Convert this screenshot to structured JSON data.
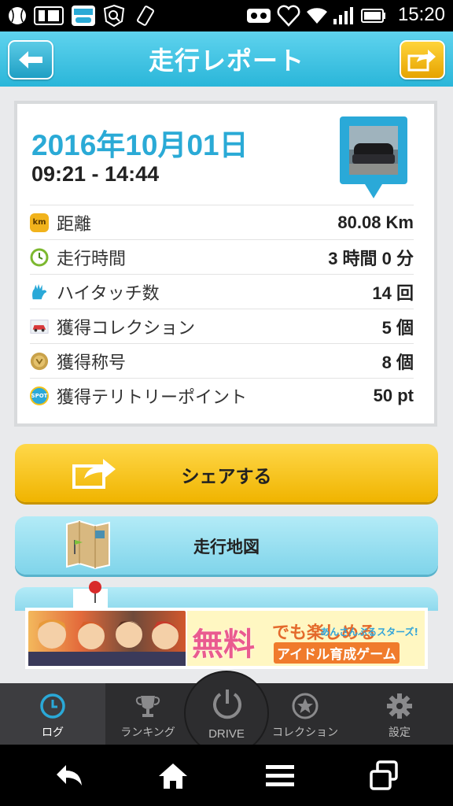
{
  "status_bar": {
    "time": "15:20",
    "icons": [
      "baseball-icon",
      "sim-icon",
      "app-notification-icon",
      "search-notification-icon",
      "rotate-icon",
      "vr-icon",
      "heart-icon",
      "wifi-icon",
      "signal-icon",
      "battery-icon"
    ]
  },
  "header": {
    "title": "走行レポート",
    "back_icon": "back-arrow-icon",
    "share_icon": "share-icon"
  },
  "report": {
    "date": "2016年10月01日",
    "time_range": "09:21 - 14:44",
    "rows": [
      {
        "icon": "km-icon",
        "icon_text": "km",
        "label": "距離",
        "value": "80.08 Km"
      },
      {
        "icon": "clock-icon",
        "label": "走行時間",
        "value": "3 時間 0 分"
      },
      {
        "icon": "hightouch-icon",
        "label": "ハイタッチ数",
        "value": "14 回"
      },
      {
        "icon": "car-icon",
        "label": "獲得コレクション",
        "value": "5 個"
      },
      {
        "icon": "medal-icon",
        "label": "獲得称号",
        "value": "8 個"
      },
      {
        "icon": "spot-icon",
        "icon_text": "SPOT",
        "label": "獲得テリトリーポイント",
        "value": "50 pt"
      }
    ]
  },
  "buttons": {
    "share": "シェアする",
    "map": "走行地図"
  },
  "ad": {
    "headline": "無料",
    "line1": "でも楽しめる",
    "line2": "アイドル育成ゲーム",
    "logo": "あんさんぶるスターズ!"
  },
  "tabs": [
    {
      "id": "log",
      "label": "ログ"
    },
    {
      "id": "ranking",
      "label": "ランキング"
    },
    {
      "id": "drive",
      "label": "DRIVE"
    },
    {
      "id": "collection",
      "label": "コレクション"
    },
    {
      "id": "settings",
      "label": "設定"
    }
  ],
  "colors": {
    "accent": "#2aaad6",
    "share_yellow": "#f0b400",
    "map_blue": "#8fd9ed",
    "tab_bg": "#2d2d2f"
  }
}
